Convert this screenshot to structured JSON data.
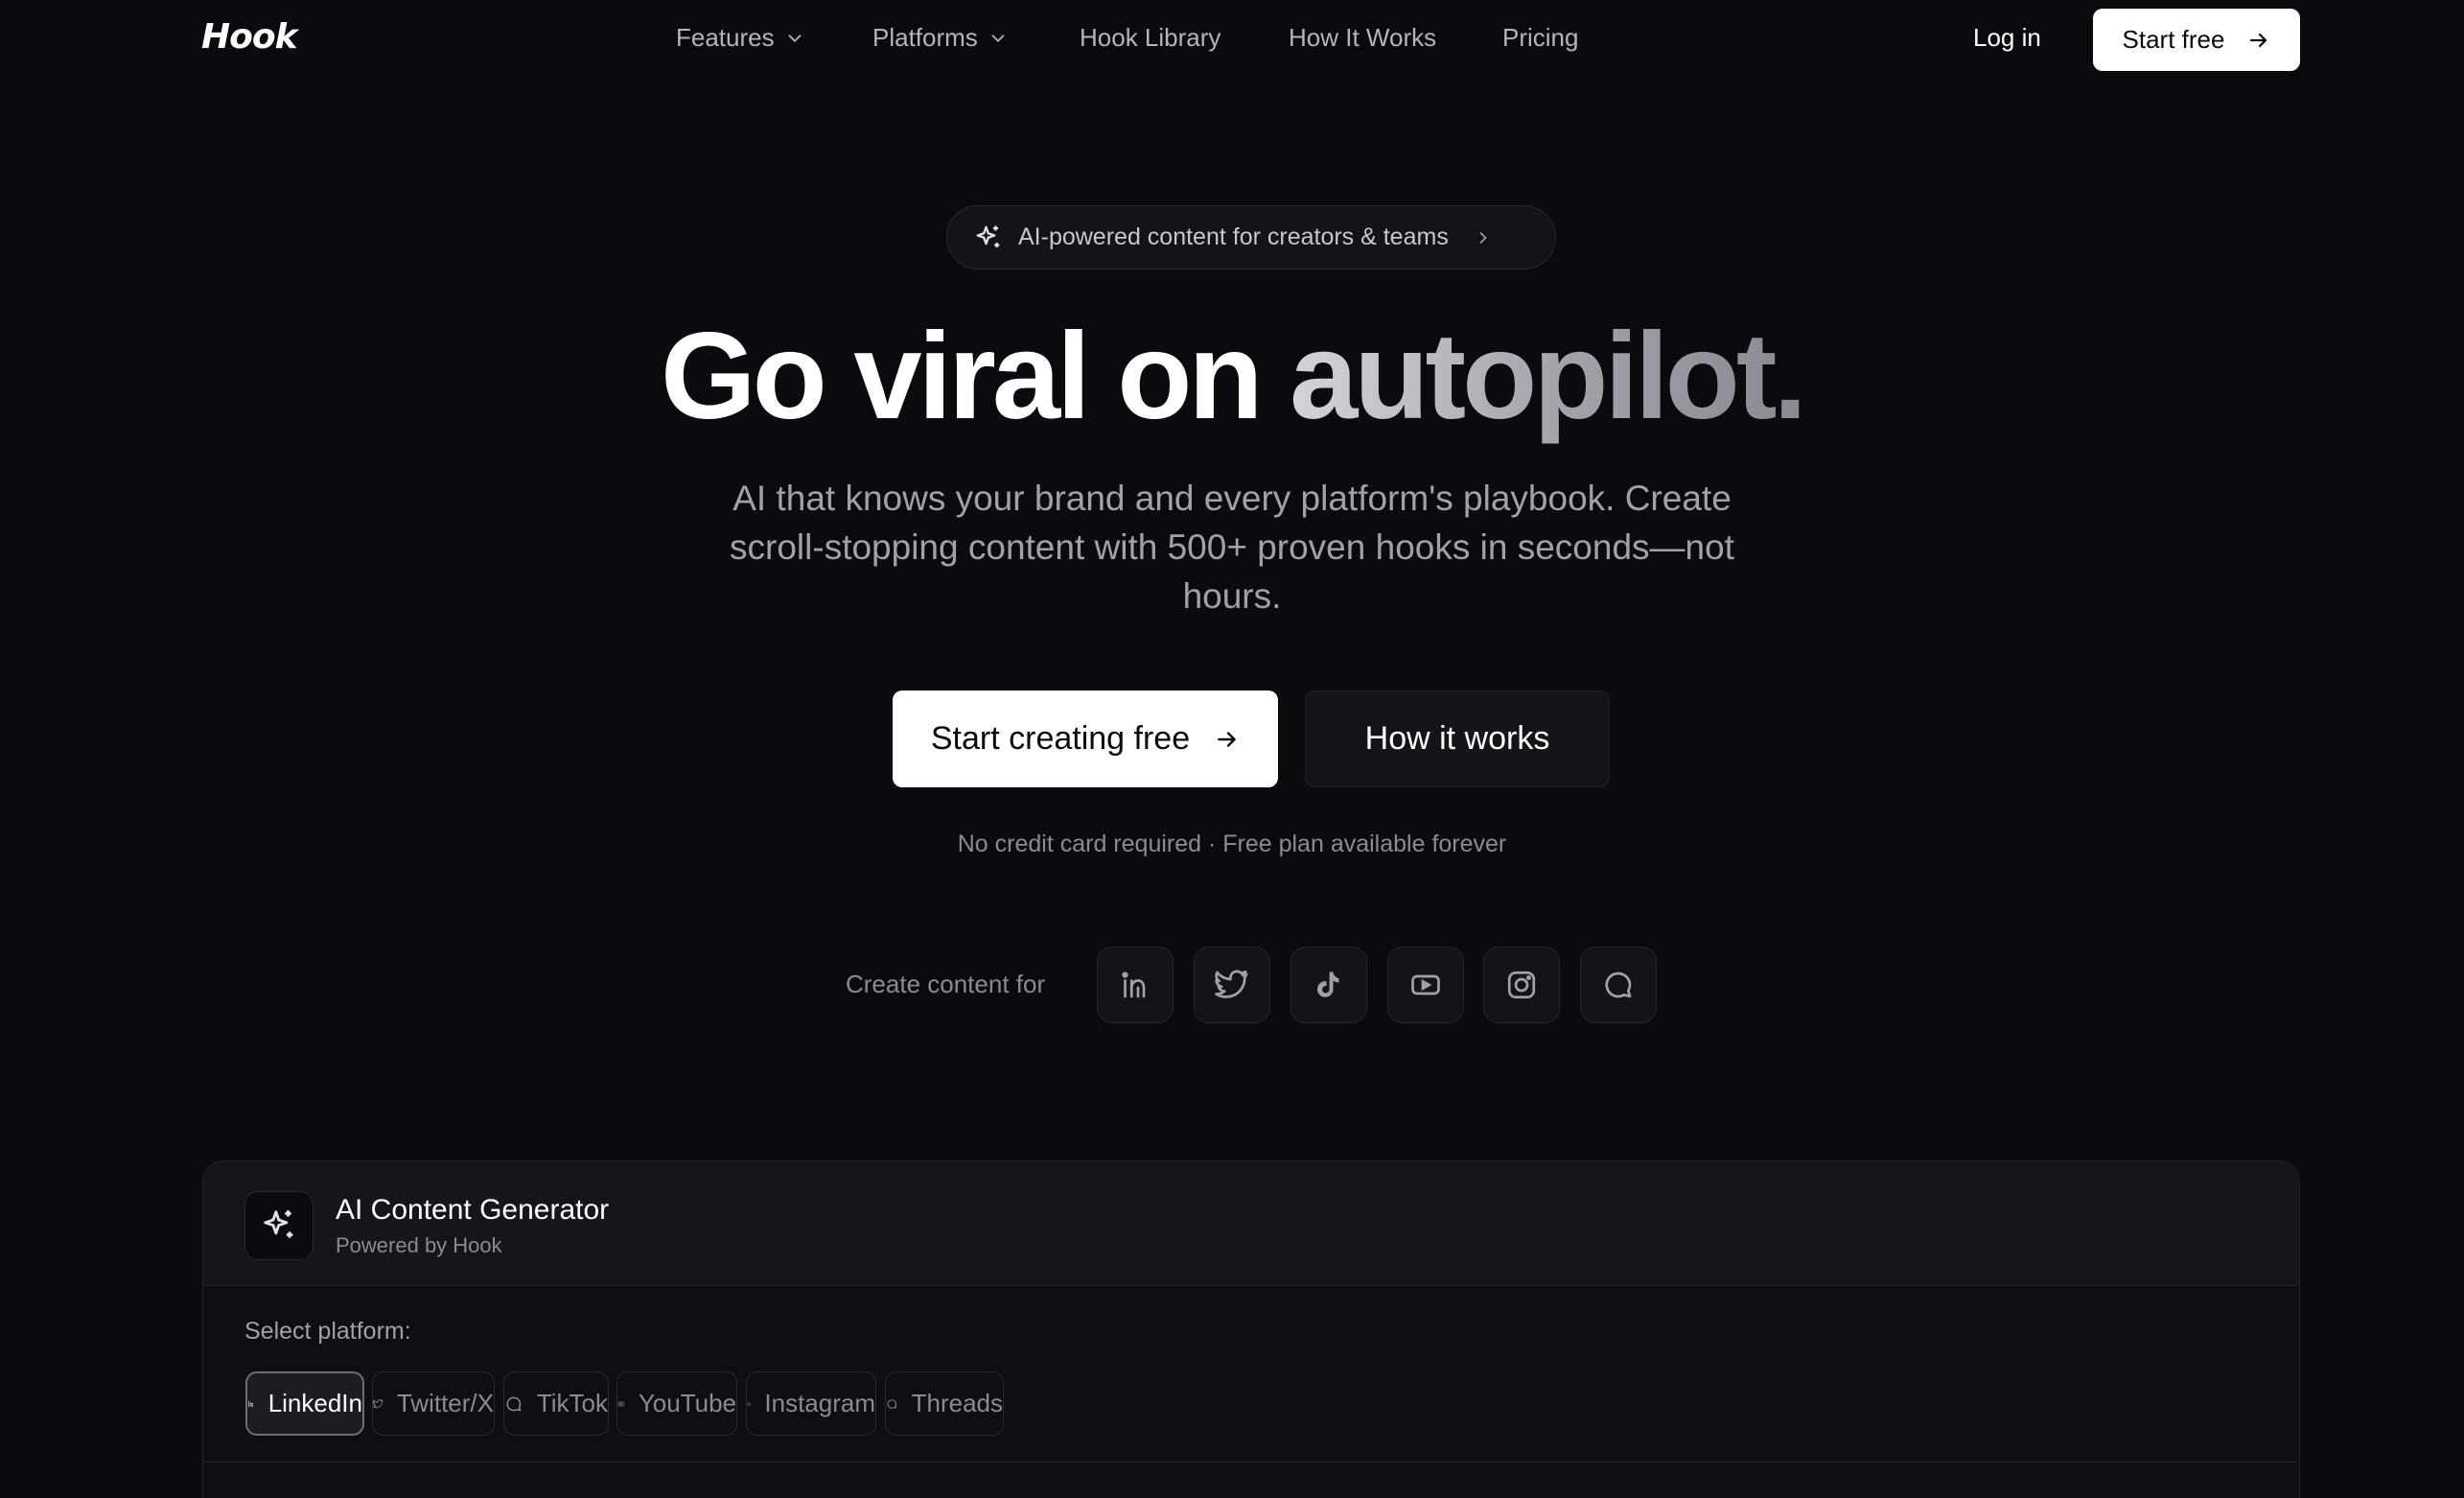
{
  "header": {
    "logo": "Hook",
    "nav": [
      {
        "label": "Features",
        "dropdown": true
      },
      {
        "label": "Platforms",
        "dropdown": true
      },
      {
        "label": "Hook Library",
        "dropdown": false
      },
      {
        "label": "How It Works",
        "dropdown": false
      },
      {
        "label": "Pricing",
        "dropdown": false
      }
    ],
    "login_label": "Log in",
    "start_label": "Start free"
  },
  "hero": {
    "badge": "AI-powered content for creators & teams",
    "headline_white": "Go viral on ",
    "headline_gradient": "autopilot.",
    "subhead": "AI that knows your brand and every platform's playbook. Create scroll-stopping content with 500+ proven hooks in seconds—not hours.",
    "cta_primary": "Start creating free",
    "cta_secondary": "How it works",
    "note": "No credit card required · Free plan available forever"
  },
  "create_for": {
    "label": "Create content for",
    "icons": [
      "linkedin-icon",
      "twitter-icon",
      "tiktok-icon",
      "youtube-icon",
      "instagram-icon",
      "threads-icon"
    ]
  },
  "generator": {
    "title": "AI Content Generator",
    "subtitle": "Powered by Hook",
    "select_label": "Select platform:",
    "platforms": [
      {
        "label": "LinkedIn",
        "icon": "linkedin-icon",
        "active": true
      },
      {
        "label": "Twitter/X",
        "icon": "twitter-icon",
        "active": false
      },
      {
        "label": "TikTok",
        "icon": "chat-bubble-icon",
        "active": false
      },
      {
        "label": "YouTube",
        "icon": "youtube-icon",
        "active": false
      },
      {
        "label": "Instagram",
        "icon": "instagram-icon",
        "active": false
      },
      {
        "label": "Threads",
        "icon": "chat-bubble-icon",
        "active": false
      }
    ]
  },
  "colors": {
    "background": "#0b0b0f",
    "primary_button": "#ffffff",
    "muted_text": "#8b8b93"
  }
}
